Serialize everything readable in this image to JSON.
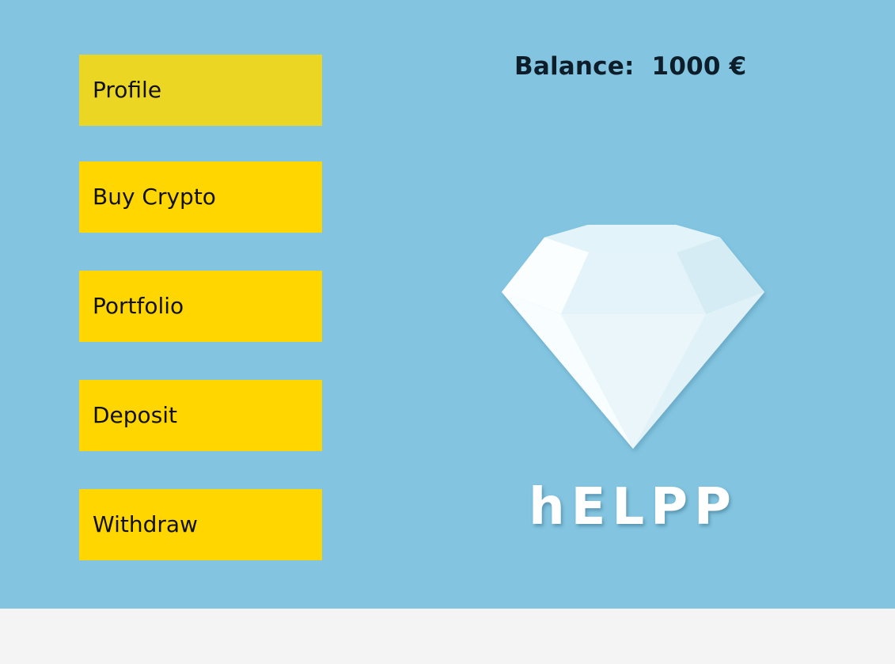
{
  "menu": {
    "items": [
      {
        "label": "Profile",
        "active": true
      },
      {
        "label": "Buy Crypto",
        "active": false
      },
      {
        "label": "Portfolio",
        "active": false
      },
      {
        "label": "Deposit",
        "active": false
      },
      {
        "label": "Withdraw",
        "active": false
      }
    ]
  },
  "balance": {
    "text": "Balance:  1000 €"
  },
  "brand": {
    "wordmark": "hELPP",
    "logo_icon": "diamond-icon"
  },
  "colors": {
    "background": "#83c5e0",
    "button": "#ffd600",
    "button_active": "#ecd624",
    "text": "#111111",
    "footer": "#f4f4f4"
  }
}
